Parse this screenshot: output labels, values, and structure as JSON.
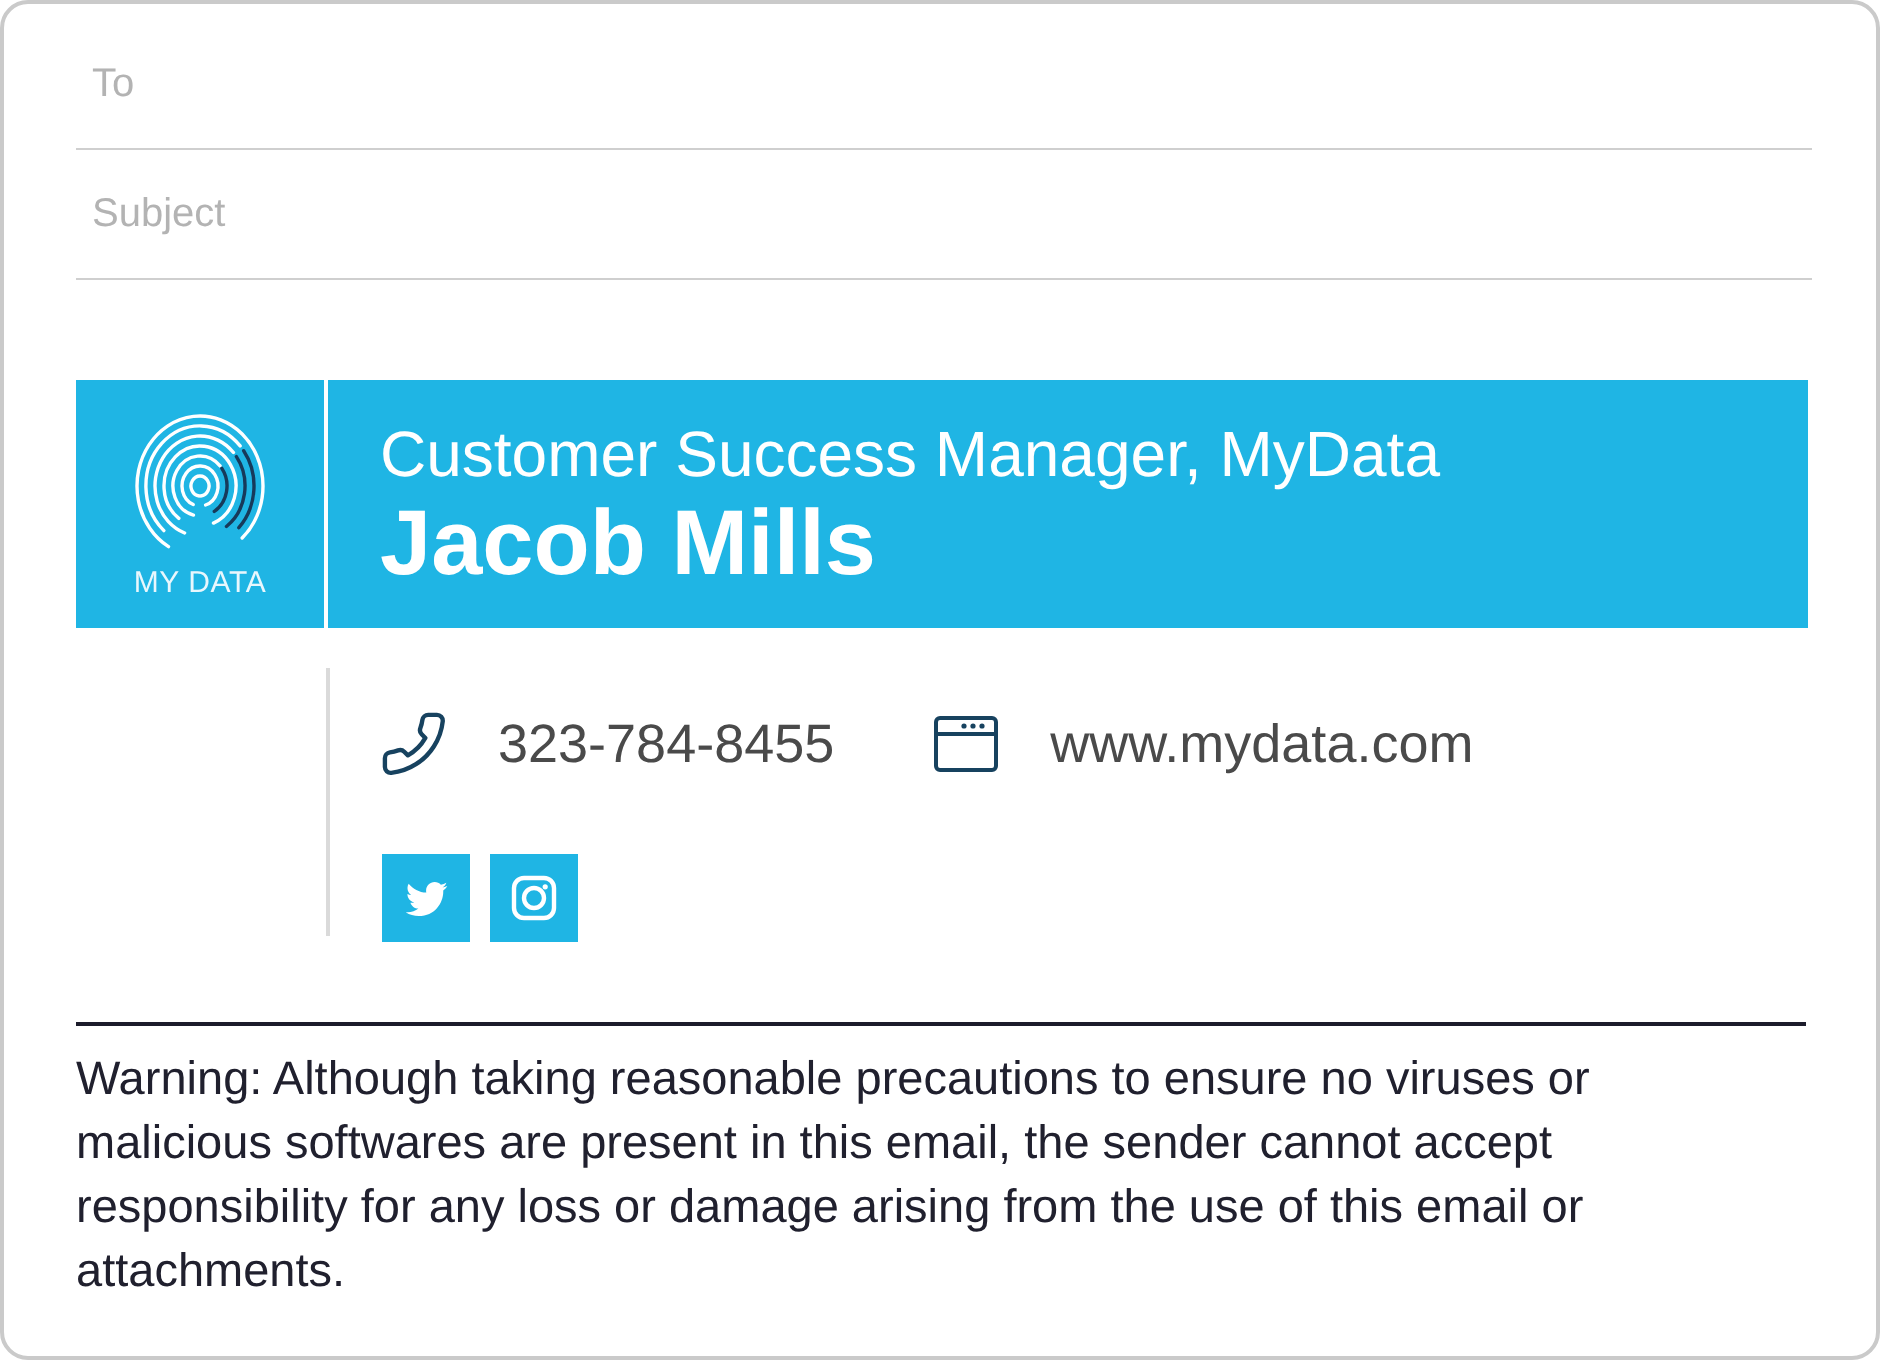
{
  "compose": {
    "to": {
      "placeholder": "To"
    },
    "subject": {
      "placeholder": "Subject"
    }
  },
  "signature": {
    "logo": {
      "text": "MY DATA"
    },
    "job_title": "Customer Success Manager, MyData",
    "name": "Jacob Mills",
    "contacts": [
      {
        "kind": "phone",
        "text": "323-784-8455"
      },
      {
        "kind": "website",
        "text": "www.mydata.com"
      }
    ],
    "social": [
      {
        "kind": "twitter"
      },
      {
        "kind": "instagram"
      }
    ]
  },
  "disclaimer": "Warning: Although taking reasonable precautions to ensure no viruses or malicious softwares are present in this email, the sender cannot accept responsibility for any loss or damage arising from the use of this email or attachments."
}
